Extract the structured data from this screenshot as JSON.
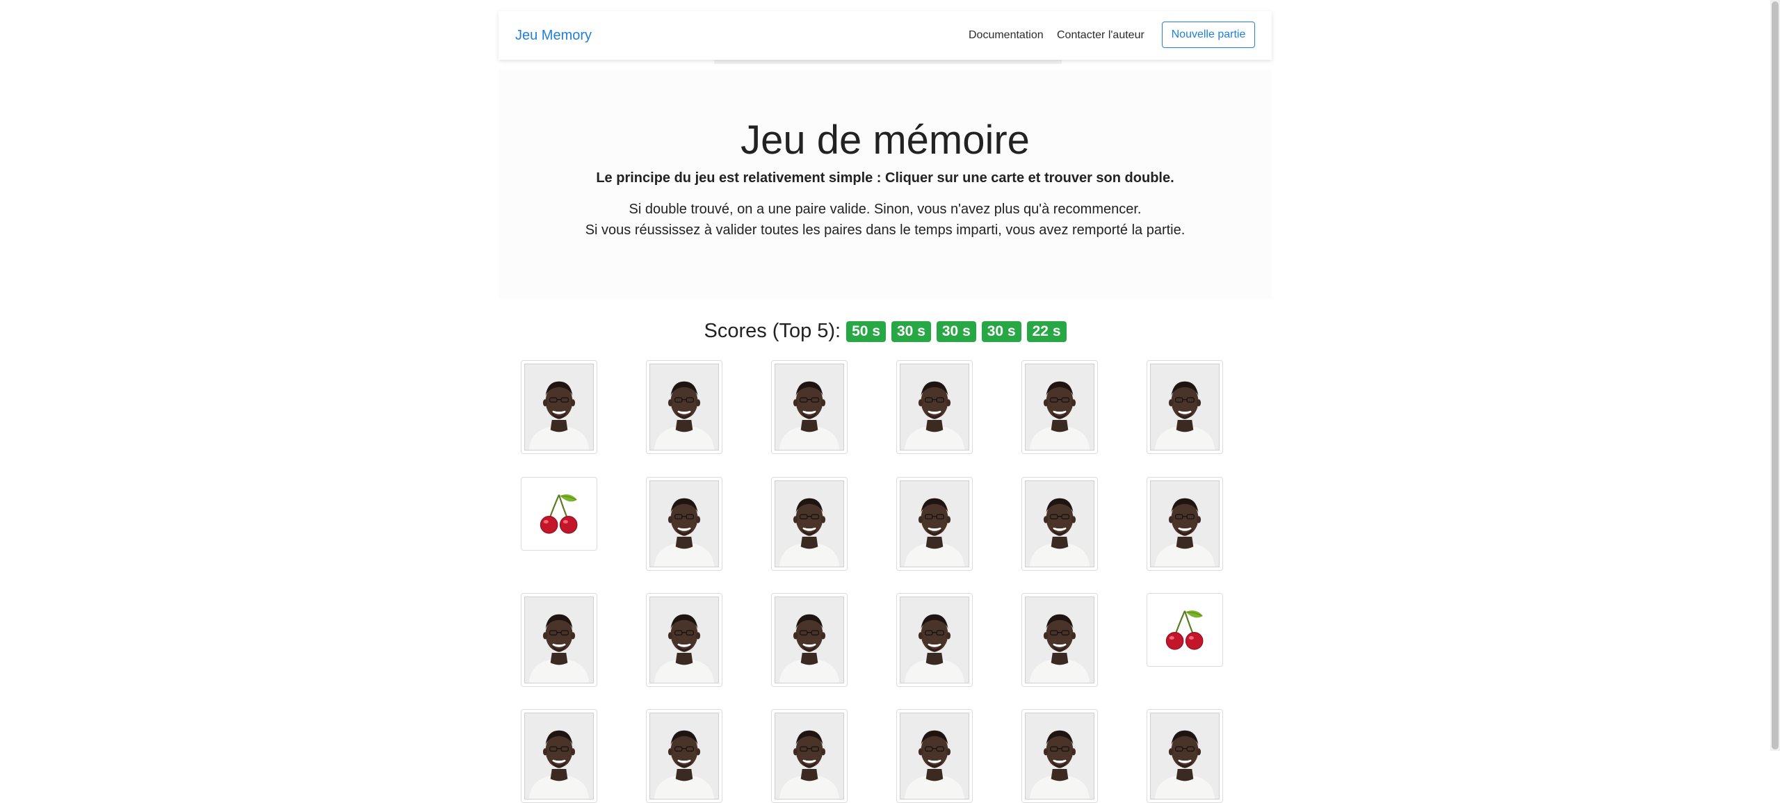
{
  "navbar": {
    "brand": "Jeu Memory",
    "links": [
      "Documentation",
      "Contacter l'auteur"
    ],
    "new_game_label": "Nouvelle partie"
  },
  "intro": {
    "title": "Jeu de mémoire",
    "lead": "Le principe du jeu est relativement simple : Cliquer sur une carte et trouver son double.",
    "line1": "Si double trouvé, on a une paire valide. Sinon, vous n'avez plus qu'à recommencer.",
    "line2": "Si vous réussissez à valider toutes les paires dans le temps imparti, vous avez remporté la partie."
  },
  "scores": {
    "label": "Scores (Top 5):",
    "values": [
      "50 s",
      "30 s",
      "30 s",
      "30 s",
      "22 s"
    ]
  },
  "board": {
    "columns": 6,
    "rows": [
      [
        "back",
        "back",
        "back",
        "back",
        "back",
        "back"
      ],
      [
        "cherry",
        "back",
        "back",
        "back",
        "back",
        "back"
      ],
      [
        "back",
        "back",
        "back",
        "back",
        "back",
        "cherry"
      ],
      [
        "back",
        "back",
        "back",
        "back",
        "back",
        "back"
      ]
    ]
  },
  "colors": {
    "brand": "#1f7fdb",
    "badge": "#28a745"
  }
}
